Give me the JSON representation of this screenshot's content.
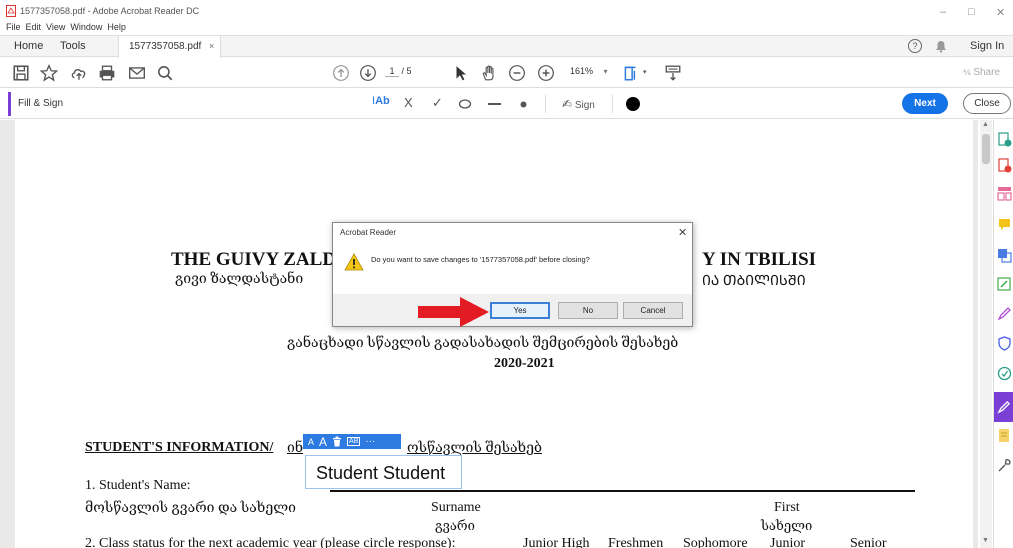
{
  "window": {
    "title": "1577357058.pdf - Adobe Acrobat Reader DC",
    "minimize": "–",
    "maximize": "□",
    "close": "✕"
  },
  "menu": [
    "File",
    "Edit",
    "View",
    "Window",
    "Help"
  ],
  "tabs": {
    "home": "Home",
    "tools": "Tools",
    "document": "1577357058.pdf",
    "document_close": "×"
  },
  "account": {
    "sign_in": "Sign In",
    "help_icon": "?",
    "bell_icon": "bell"
  },
  "toolbar": {
    "page_current": "1",
    "page_total": "/ 5",
    "zoom": "161%",
    "share": "Share"
  },
  "fill_sign": {
    "title": "Fill & Sign",
    "text_tool": "Ab",
    "cross": "X",
    "check": "✓",
    "sign_label": "Sign",
    "next": "Next",
    "close": "Close",
    "color": "#000000"
  },
  "document": {
    "heading_en_left": "THE GUIVY ZALD",
    "heading_en_right": "Y IN TBILISI",
    "heading_ka_left": "გივი ზალდასტანი",
    "heading_ka_right": "ᲘᲐ ᲗᲑᲘᲚᲘᲡᲨᲘ",
    "subtitle_ka": "განაცხადი სწავლის გადასახადის შემცირების შესახებ",
    "year": "2020-2021",
    "section_en": "STUDENT'S INFORMATION/",
    "section_ka_prefix": "ინ",
    "section_ka_suffix": "ოსწავლის შესახებ",
    "field1_en": "1. Student's Name:",
    "field1_ka": "მოსწავლის     გვარი და სახელი",
    "col_surname": "Surname",
    "col_surname_ka": "გვარი",
    "col_first": "First",
    "col_first_ka": "სახელი",
    "field2": "2. Class status for the next academic year (please circle response):",
    "class_junior_high": "Junior High",
    "class_freshmen": "Freshmen",
    "class_sophomore": "Sophomore",
    "class_junior": "Junior",
    "class_senior": "Senior"
  },
  "mini_toolbar": {
    "smaller": "A",
    "larger": "A",
    "delete_icon": "trash",
    "field_icon": "AB",
    "more": "···"
  },
  "text_field": {
    "value": "Student Student"
  },
  "dialog": {
    "title": "Acrobat Reader",
    "message": "Do you want to save changes to '1577357058.pdf' before closing?",
    "yes": "Yes",
    "no": "No",
    "cancel": "Cancel",
    "close": "✕"
  },
  "colors": {
    "accent_purple": "#7b3fd6",
    "next_blue": "#1473e6",
    "arrow_red": "#e21c22"
  }
}
